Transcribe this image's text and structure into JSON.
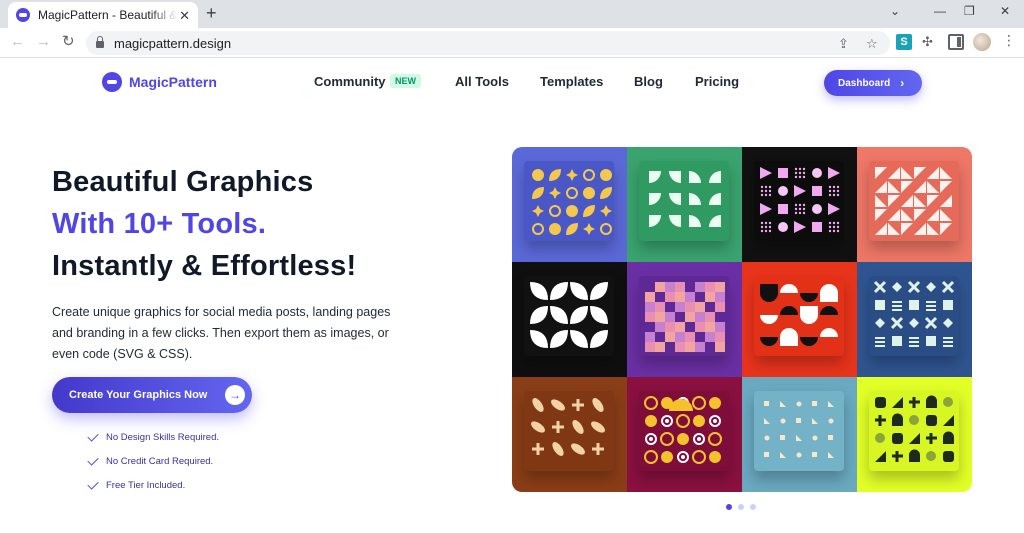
{
  "browser": {
    "tab_title": "MagicPattern - Beautiful & cool",
    "url": "magicpattern.design",
    "extension_letter": "S"
  },
  "site": {
    "logo_text": "MagicPattern",
    "nav": {
      "community": "Community",
      "community_badge": "NEW",
      "all_tools": "All Tools",
      "templates": "Templates",
      "blog": "Blog",
      "pricing": "Pricing"
    },
    "dashboard_button": "Dashboard"
  },
  "hero": {
    "line1": "Beautiful Graphics",
    "line2": "With 10+ Tools.",
    "line3": "Instantly & Effortless!",
    "description": "Create unique graphics for social media posts, landing pages and branding in a few clicks. Then export them as images, or even code (SVG & CSS).",
    "cta_label": "Create Your Graphics Now",
    "checks": [
      "No Design Skills Required.",
      "No Credit Card Required.",
      "Free Tier Included."
    ]
  },
  "gallery": {
    "tiles": [
      {
        "name": "tile-blue-shapes",
        "bg": "#5b69d8",
        "card": "#4a57c7"
      },
      {
        "name": "tile-green-quarters",
        "bg": "#3aa36f",
        "card": "#2f9a62"
      },
      {
        "name": "tile-black-triangles",
        "bg": "#111111",
        "card": "#0c0c0c"
      },
      {
        "name": "tile-salmon-triangles",
        "bg": "#ee7766",
        "card": "#e56a59"
      },
      {
        "name": "tile-black-leaves",
        "bg": "#0f0f0f",
        "card": "#111111"
      },
      {
        "name": "tile-purple-pixels",
        "bg": "#6b2fa5",
        "card": "#5e2896"
      },
      {
        "name": "tile-red-halfcircles",
        "bg": "#e9341c",
        "card": "#e23116"
      },
      {
        "name": "tile-navy-symbols",
        "bg": "#2f5591",
        "card": "#2a4d86"
      },
      {
        "name": "tile-brown-petals",
        "bg": "#8a3e17",
        "card": "#7f3813"
      },
      {
        "name": "tile-maroon-circles",
        "bg": "#8a1040",
        "card": "#7e0d39"
      },
      {
        "name": "tile-teal-dots",
        "bg": "#6aa9c0",
        "card": "#74b2c8"
      },
      {
        "name": "tile-lime-shapes",
        "bg": "#e2ff27",
        "card": "#d8f524"
      }
    ],
    "carousel_active": 1,
    "carousel_count": 3
  }
}
